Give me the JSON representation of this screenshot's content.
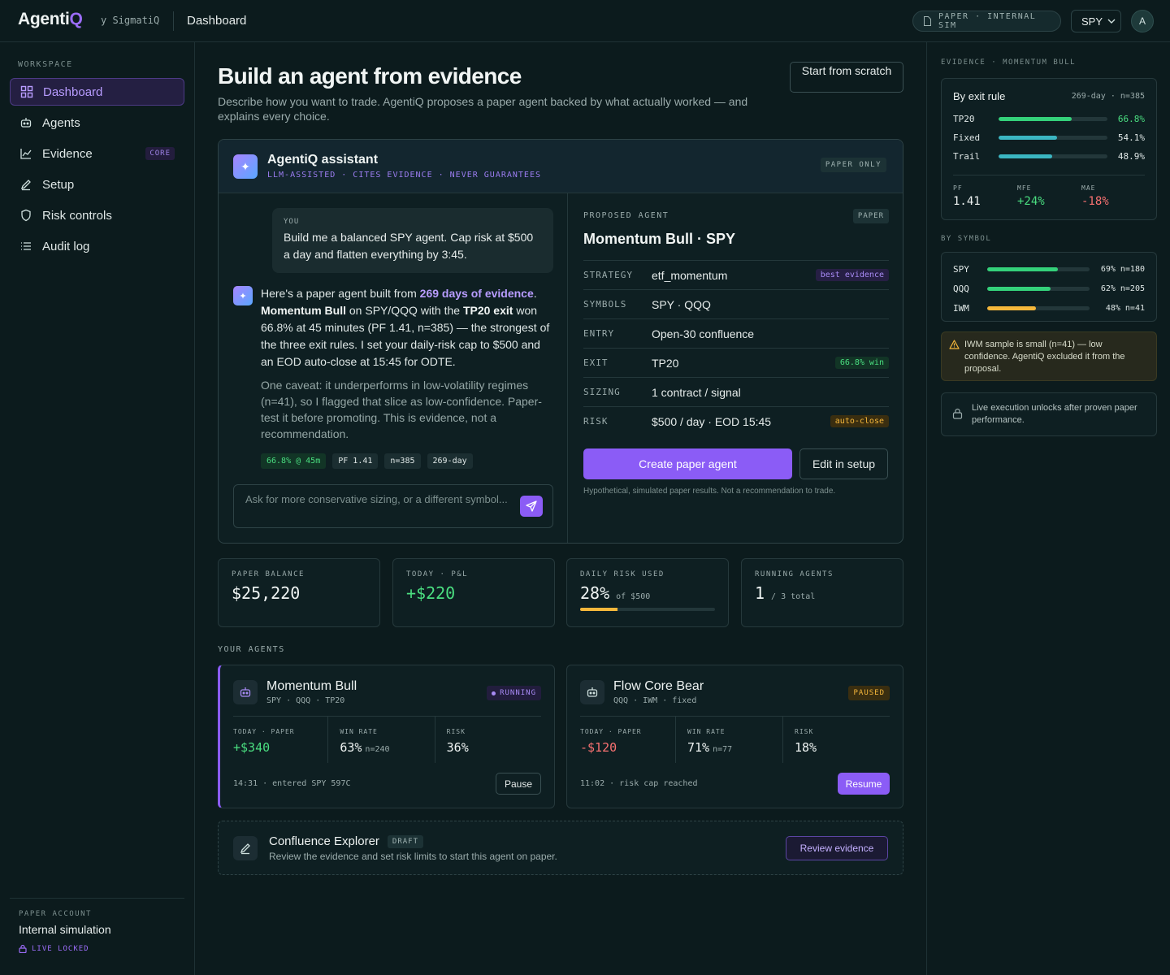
{
  "topbar": {
    "logo_main": "Agenti",
    "logo_accent": "Q",
    "byline": "y SigmatiQ",
    "breadcrumb": "Dashboard",
    "sim_pill": "PAPER · INTERNAL SIM",
    "symbol": "SPY",
    "avatar": "A"
  },
  "sidebar": {
    "section": "WORKSPACE",
    "items": [
      {
        "label": "Dashboard",
        "icon": "grid-icon"
      },
      {
        "label": "Agents",
        "icon": "bot-icon"
      },
      {
        "label": "Evidence",
        "icon": "chart-icon",
        "badge": "CORE"
      },
      {
        "label": "Setup",
        "icon": "pencil-icon"
      },
      {
        "label": "Risk controls",
        "icon": "shield-icon"
      },
      {
        "label": "Audit log",
        "icon": "list-icon"
      }
    ],
    "account_label": "PAPER ACCOUNT",
    "account_name": "Internal simulation",
    "live_locked": "LIVE LOCKED"
  },
  "header": {
    "title": "Build an agent from evidence",
    "subtitle": "Describe how you want to trade. AgentiQ proposes a paper agent backed by what actually worked — and explains every choice.",
    "scratch_button": "Start from scratch"
  },
  "assistant": {
    "title": "AgentiQ assistant",
    "subtitle": "LLM-ASSISTED · CITES EVIDENCE · NEVER GUARANTEES",
    "badge": "PAPER ONLY",
    "you_label": "YOU",
    "user_message": "Build me a balanced SPY agent. Cap risk at $500 a day and flatten everything by 3:45.",
    "ai_msg": {
      "p1": "Here's a paper agent built from ",
      "link": "269 days of evidence",
      "p2": ".",
      "name": "Momentum Bull",
      "p3": " on SPY/QQQ with the ",
      "exit": "TP20 exit",
      "p4": " won 66.8% at 45 minutes (PF 1.41, n=385) — the strongest of the three exit rules. I set your daily-risk cap to $500 and an EOD auto-close at 15:45 for ODTE."
    },
    "caveat": "One caveat: it underperforms in low-volatility regimes (n=41), so I flagged that slice as low-confidence. Paper-test it before promoting. This is evidence, not a recommendation.",
    "chips": [
      "66.8% @ 45m",
      "PF 1.41",
      "n=385",
      "269-day"
    ],
    "input_placeholder": "Ask for more conservative sizing, or a different symbol..."
  },
  "proposal": {
    "label": "PROPOSED AGENT",
    "badge": "PAPER",
    "name": "Momentum Bull · SPY",
    "rows": [
      {
        "k": "STRATEGY",
        "v": "etf_momentum",
        "tag": "best evidence"
      },
      {
        "k": "SYMBOLS",
        "v": "SPY · QQQ"
      },
      {
        "k": "ENTRY",
        "v": "Open-30 confluence"
      },
      {
        "k": "EXIT",
        "v": "TP20",
        "tag": "66.8% win"
      },
      {
        "k": "SIZING",
        "v": "1 contract / signal"
      },
      {
        "k": "RISK",
        "v": "$500 / day · EOD 15:45",
        "tag": "auto-close"
      }
    ],
    "create_button": "Create paper agent",
    "edit_button": "Edit in setup",
    "disclaimer": "Hypothetical, simulated paper results. Not a recommendation to trade."
  },
  "stats": [
    {
      "label": "PAPER BALANCE",
      "value": "$25,220"
    },
    {
      "label": "TODAY · P&L",
      "value": "+$220"
    },
    {
      "label": "DAILY RISK USED",
      "value": "28%",
      "note": "of $500",
      "progress": 0.28
    },
    {
      "label": "RUNNING AGENTS",
      "value": "1",
      "note": "/ 3 total"
    }
  ],
  "your_agents_label": "YOUR AGENTS",
  "agents": [
    {
      "name": "Momentum Bull",
      "symbols": "SPY · QQQ · TP20",
      "status": "RUNNING",
      "today_label": "TODAY · PAPER",
      "today": "+$340",
      "win_label": "WIN RATE",
      "win": "63%",
      "win_n": "n=240",
      "risk_label": "RISK",
      "risk": "36%",
      "event": "14:31 · entered SPY 597C",
      "action": "Pause"
    },
    {
      "name": "Flow Core Bear",
      "symbols": "QQQ · IWM · fixed",
      "status": "PAUSED",
      "today_label": "TODAY · PAPER",
      "today": "-$120",
      "win_label": "WIN RATE",
      "win": "71%",
      "win_n": "n=77",
      "risk_label": "RISK",
      "risk": "18%",
      "event": "11:02 · risk cap reached",
      "action": "Resume"
    }
  ],
  "draft": {
    "name": "Confluence Explorer",
    "badge": "DRAFT",
    "desc": "Review the evidence and set risk limits to start this agent on paper.",
    "button": "Review evidence"
  },
  "evidence": {
    "label": "EVIDENCE · MOMENTUM BULL",
    "by_exit_title": "By exit rule",
    "by_exit_meta": "269-day · n=385",
    "exit_rules": [
      {
        "k": "TP20",
        "v": "66.8%",
        "frac": 0.668,
        "color": "#34d17a"
      },
      {
        "k": "Fixed",
        "v": "54.1%",
        "frac": 0.541,
        "color": "#3bb6c2"
      },
      {
        "k": "Trail",
        "v": "48.9%",
        "frac": 0.489,
        "color": "#3bb6c2"
      }
    ],
    "pf_label": "PF",
    "pf": "1.41",
    "mfe_label": "MFE",
    "mfe": "+24%",
    "mae_label": "MAE",
    "mae": "-18%",
    "by_symbol_label": "BY SYMBOL",
    "symbols": [
      {
        "k": "SPY",
        "v": "69% n=180",
        "frac": 0.69,
        "color": "#34d17a"
      },
      {
        "k": "QQQ",
        "v": "62% n=205",
        "frac": 0.62,
        "color": "#34d17a"
      },
      {
        "k": "IWM",
        "v": "48% n=41",
        "frac": 0.48,
        "color": "#f5b73b"
      }
    ],
    "warning": "IWM sample is small (n=41) — low confidence. AgentiQ excluded it from the proposal.",
    "lock_note": "Live execution unlocks after proven paper performance."
  }
}
